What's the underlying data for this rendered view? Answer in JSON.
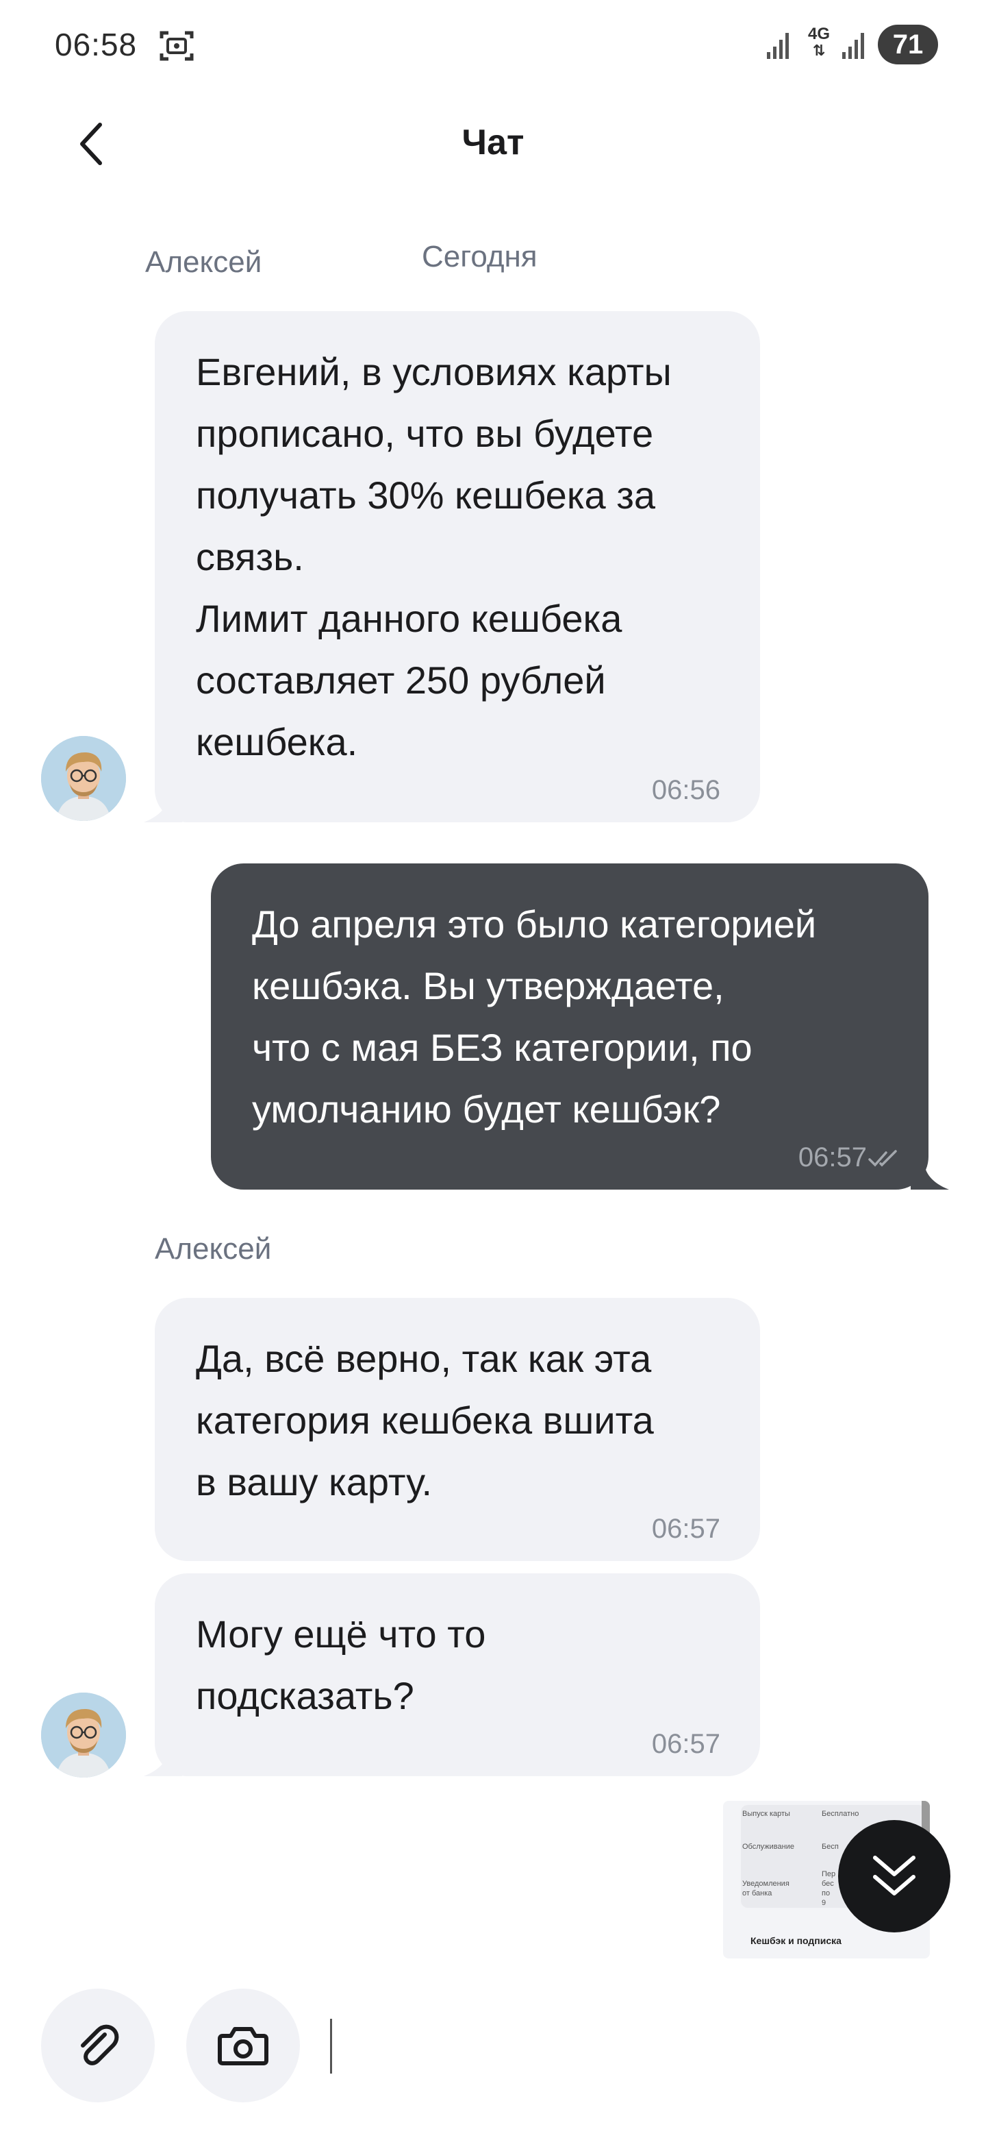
{
  "status_bar": {
    "time": "06:58",
    "network": "4G",
    "battery": "71",
    "icons": [
      "screenshot-icon",
      "signal-icon",
      "signal-icon"
    ]
  },
  "header": {
    "title": "Чат",
    "back_icon": "chevron-left-icon"
  },
  "chat": {
    "date_label": "Сегодня",
    "messages": [
      {
        "direction": "incoming",
        "sender": "Алексей",
        "text": "Евгений, в условиях карты\nпрописано, что вы будете\nполучать 30% кешбека за\nсвязь.\nЛимит данного кешбека\nсоставляет 250 рублей\nкешбека.",
        "time": "06:56"
      },
      {
        "direction": "outgoing",
        "text": "До апреля это было категорией\nкешбэка. Вы утверждаете,\nчто с мая БЕЗ категории, по\nумолчанию будет кешбэк?",
        "time": "06:57",
        "status": "read"
      },
      {
        "direction": "incoming",
        "sender": "Алексей",
        "text": "Да, всё верно, так как эта\nкатегория кешбека вшита\nв вашу карту.",
        "time": "06:57"
      },
      {
        "direction": "incoming",
        "text": "Могу ещё что то\nподсказать?",
        "time": "06:57"
      }
    ],
    "attachment_preview": {
      "rows": [
        {
          "label": "Выпуск карты",
          "value": "Бесплатно"
        },
        {
          "label": "Обслуживание",
          "value": "Бесп"
        },
        {
          "label": "Уведомления\nот банка",
          "value": "Пер\nбес\nпо 9"
        }
      ],
      "footer": "Кешбэк и подписка"
    }
  },
  "composer": {
    "attach_icon": "paperclip-icon",
    "camera_icon": "camera-icon",
    "placeholder": "",
    "value": ""
  },
  "colors": {
    "incoming_bubble": "#f1f2f6",
    "outgoing_bubble": "#46494e",
    "scroll_button": "#17181a"
  }
}
